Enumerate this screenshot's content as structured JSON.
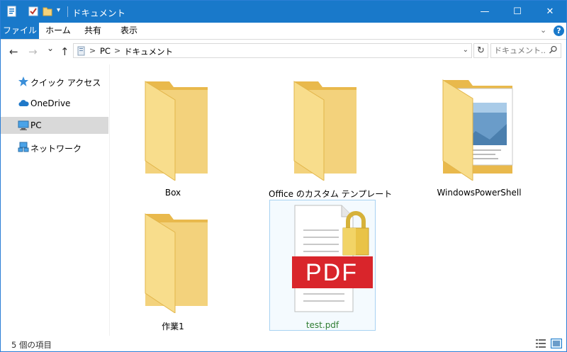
{
  "window": {
    "title": "ドキュメント",
    "controls": {
      "minimize": "—",
      "maximize": "☐",
      "close": "✕"
    }
  },
  "ribbon": {
    "tabs": [
      "ファイル",
      "ホーム",
      "共有",
      "表示"
    ],
    "help": "?"
  },
  "nav": {
    "back": "←",
    "forward": "→",
    "recent": "⌄",
    "up": "↑",
    "breadcrumb": [
      "PC",
      "ドキュメント"
    ],
    "separator": ">",
    "refresh": "↻",
    "search_placeholder": "ドキュメント..."
  },
  "sidebar": {
    "items": [
      {
        "label": "クイック アクセス",
        "icon": "star-icon"
      },
      {
        "label": "OneDrive",
        "icon": "cloud-icon"
      },
      {
        "label": "PC",
        "icon": "computer-icon",
        "selected": true
      },
      {
        "label": "ネットワーク",
        "icon": "network-icon"
      }
    ]
  },
  "files": [
    {
      "name": "Box",
      "type": "folder"
    },
    {
      "name": "Office のカスタム テンプレート",
      "type": "folder"
    },
    {
      "name": "WindowsPowerShell",
      "type": "folder-with-documents"
    },
    {
      "name": "作業1",
      "type": "folder"
    },
    {
      "name": "test.pdf",
      "type": "locked-pdf",
      "badge": "PDF",
      "selected": true
    }
  ],
  "status": {
    "item_count": "5 個の項目"
  },
  "colors": {
    "accent": "#1979ca",
    "folder": "#f5d37d",
    "folder_dark": "#e8b84a",
    "pdf_red": "#d9252b",
    "lock_gold": "#e9c347",
    "selected_label": "#2e7d32"
  }
}
